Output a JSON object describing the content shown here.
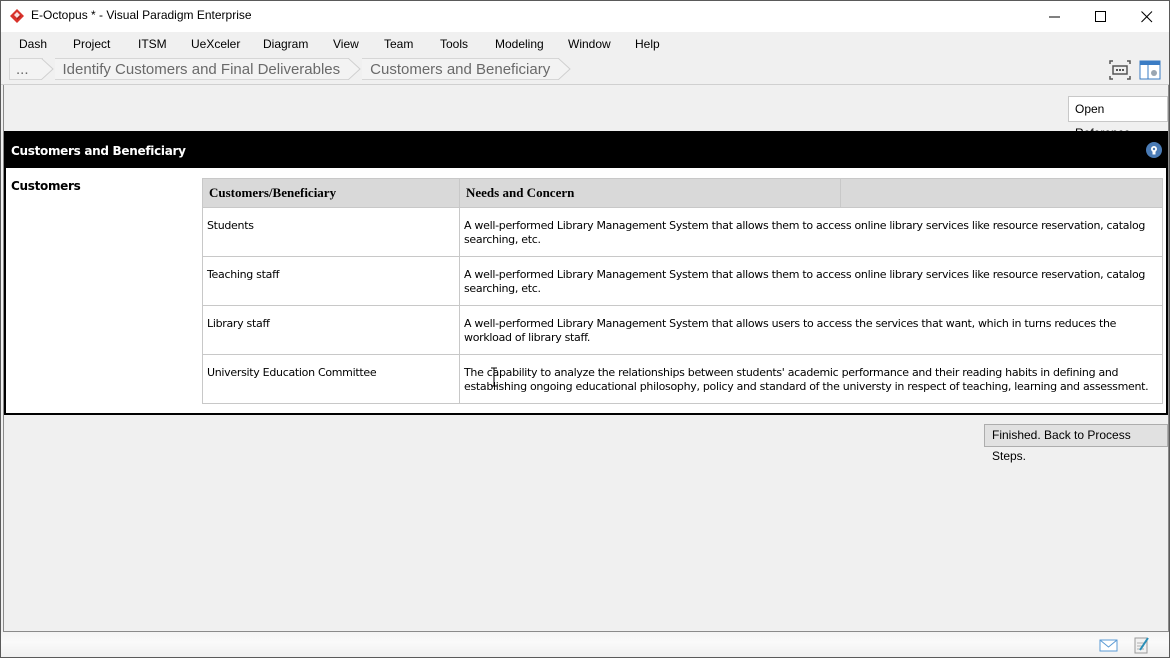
{
  "window": {
    "title": "E-Octopus * - Visual Paradigm Enterprise",
    "controls": {
      "minimize": "minimize",
      "maximize": "maximize",
      "close": "close"
    }
  },
  "menu": {
    "items": [
      "Dash",
      "Project",
      "ITSM",
      "UeXceler",
      "Diagram",
      "View",
      "Team",
      "Tools",
      "Modeling",
      "Window",
      "Help"
    ]
  },
  "breadcrumb": {
    "items": [
      "...",
      "Identify Customers and Final Deliverables",
      "Customers and Beneficiary"
    ],
    "tools": [
      "fit-screen-icon",
      "panel-layout-icon"
    ]
  },
  "toolbar": {
    "open_reference": "Open Reference"
  },
  "panel": {
    "title": "Customers and Beneficiary",
    "hint_icon": "lightbulb-icon",
    "section_label": "Customers",
    "table": {
      "headers": [
        "Customers/Beneficiary",
        "Needs and Concern",
        ""
      ],
      "rows": [
        {
          "customer": "Students",
          "needs": "A well-performed Library Management System that allows them to access online library services like resource reservation, catalog searching, etc."
        },
        {
          "customer": "Teaching staff",
          "needs": "A well-performed Library Management System that allows them to access online library services like resource reservation, catalog searching, etc."
        },
        {
          "customer": "Library staff",
          "needs": "A well-performed Library Management System that allows users to access the services that want, which in turns reduces the workload of library staff."
        },
        {
          "customer": "University Education Committee",
          "needs": "The capability to analyze the relationships between students' academic performance and their reading habits in defining and establishing ongoing educational philosophy, policy and standard of the universty in respect of teaching, learning and assessment."
        }
      ]
    }
  },
  "footer": {
    "finish_button": "Finished. Back to Process Steps."
  },
  "statusbar": {
    "icons": [
      "mail-icon",
      "edit-document-icon"
    ]
  },
  "colors": {
    "brand_red": "#d9322b",
    "header_black": "#000000",
    "table_header_bg": "#d9d9d9",
    "hint_blue": "#4a7bb5"
  }
}
